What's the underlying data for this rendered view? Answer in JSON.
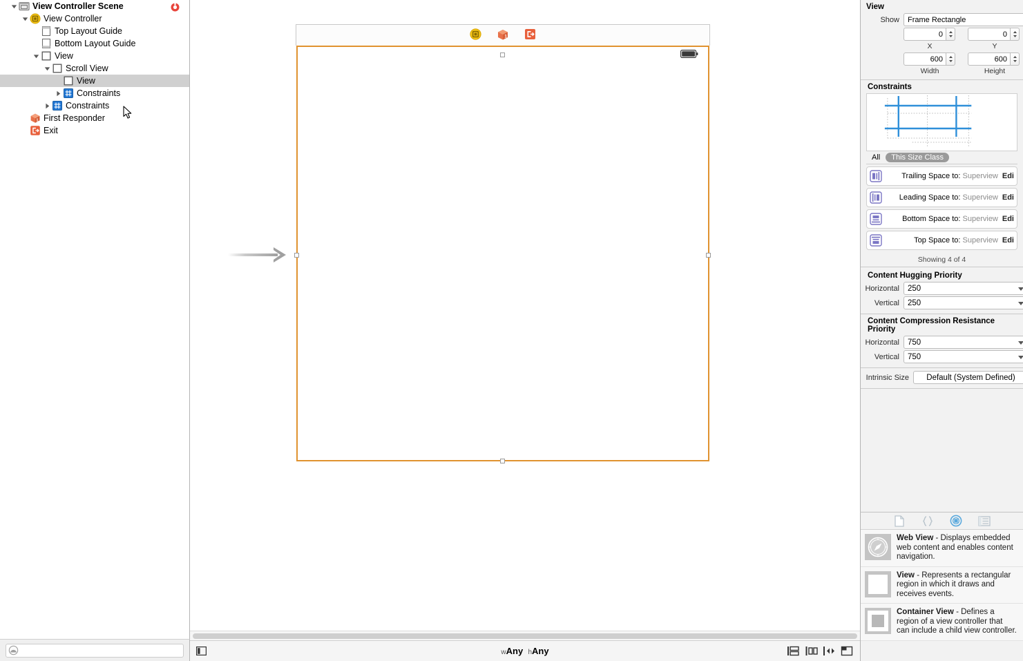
{
  "outline": {
    "rows": [
      {
        "label": "View Controller Scene",
        "indent": 0,
        "disclosure": "down",
        "icon": "scene-icon",
        "bold": true,
        "selected": false,
        "badge": "error-badge"
      },
      {
        "label": "View Controller",
        "indent": 1,
        "disclosure": "down",
        "icon": "view-controller-icon",
        "bold": false,
        "selected": false
      },
      {
        "label": "Top Layout Guide",
        "indent": 2,
        "disclosure": "none",
        "icon": "top-layout-guide-icon",
        "bold": false,
        "selected": false
      },
      {
        "label": "Bottom Layout Guide",
        "indent": 2,
        "disclosure": "none",
        "icon": "bottom-layout-guide-icon",
        "bold": false,
        "selected": false
      },
      {
        "label": "View",
        "indent": 2,
        "disclosure": "down",
        "icon": "view-icon",
        "bold": false,
        "selected": false
      },
      {
        "label": "Scroll View",
        "indent": 3,
        "disclosure": "down",
        "icon": "scroll-view-icon",
        "bold": false,
        "selected": false
      },
      {
        "label": "View",
        "indent": 4,
        "disclosure": "none",
        "icon": "view-icon",
        "bold": false,
        "selected": true
      },
      {
        "label": "Constraints",
        "indent": 4,
        "disclosure": "right",
        "icon": "constraints-icon",
        "bold": false,
        "selected": false
      },
      {
        "label": "Constraints",
        "indent": 3,
        "disclosure": "right",
        "icon": "constraints-icon",
        "bold": false,
        "selected": false
      },
      {
        "label": "First Responder",
        "indent": 1,
        "disclosure": "none",
        "icon": "first-responder-icon",
        "bold": false,
        "selected": false
      },
      {
        "label": "Exit",
        "indent": 1,
        "disclosure": "none",
        "icon": "exit-icon",
        "bold": false,
        "selected": false
      }
    ],
    "filter_placeholder": ""
  },
  "canvas": {
    "dock_icons": [
      "view-controller-icon",
      "first-responder-icon",
      "exit-icon"
    ],
    "selected_frame_color": "#e0922f"
  },
  "canvas_bar": {
    "size_class_w_prefix": "w",
    "size_class_w_value": "Any",
    "size_class_h_prefix": "h",
    "size_class_h_value": "Any",
    "left_toggle": "document-outline-toggle",
    "right_buttons": [
      "stack-button",
      "align-button",
      "pin-button",
      "resolve-issues-button"
    ]
  },
  "inspector": {
    "title": "View",
    "show_label": "Show",
    "show_value": "Frame Rectangle",
    "x_value": "0",
    "x_label": "X",
    "y_value": "0",
    "y_label": "Y",
    "width_value": "600",
    "width_label": "Width",
    "height_value": "600",
    "height_label": "Height",
    "constraints_head": "Constraints",
    "filter_all": "All",
    "filter_this_size_class": "This Size Class",
    "constraint_rows": [
      {
        "icon": "trailing-space-constraint-icon",
        "label": "Trailing Space to:",
        "target": "Superview",
        "edit": "Edi"
      },
      {
        "icon": "leading-space-constraint-icon",
        "label": "Leading Space to:",
        "target": "Superview",
        "edit": "Edi"
      },
      {
        "icon": "bottom-space-constraint-icon",
        "label": "Bottom Space to:",
        "target": "Superview",
        "edit": "Edi"
      },
      {
        "icon": "top-space-constraint-icon",
        "label": "Top Space to:",
        "target": "Superview",
        "edit": "Edi"
      }
    ],
    "showing_text": "Showing 4 of 4",
    "hugging_head": "Content Hugging Priority",
    "hugging_h_label": "Horizontal",
    "hugging_h_value": "250",
    "hugging_v_label": "Vertical",
    "hugging_v_value": "250",
    "compression_head": "Content Compression Resistance Priority",
    "compression_h_label": "Horizontal",
    "compression_h_value": "750",
    "compression_v_label": "Vertical",
    "compression_v_value": "750",
    "intrinsic_label": "Intrinsic Size",
    "intrinsic_value": "Default (System Defined)"
  },
  "library": {
    "tabs": [
      {
        "name": "file-template-library-tab",
        "selected": false
      },
      {
        "name": "code-snippet-library-tab",
        "selected": false
      },
      {
        "name": "object-library-tab",
        "selected": true
      },
      {
        "name": "media-library-tab",
        "selected": false
      }
    ],
    "items": [
      {
        "icon": "web-view-icon",
        "title": "Web View",
        "desc": " - Displays embedded web content and enables content navigation."
      },
      {
        "icon": "view-icon",
        "title": "View",
        "desc": " - Represents a rectangular region in which it draws and receives events."
      },
      {
        "icon": "container-view-icon",
        "title": "Container View",
        "desc": " - Defines a region of a view controller that can include a child view controller."
      }
    ]
  },
  "colors": {
    "selection_orange": "#e0922f",
    "constraint_blue": "#2e8fd9",
    "tree_selected": "#d0d0d0",
    "error_red": "#e8453c",
    "constraint_icon_purple": "#7b76c4"
  }
}
